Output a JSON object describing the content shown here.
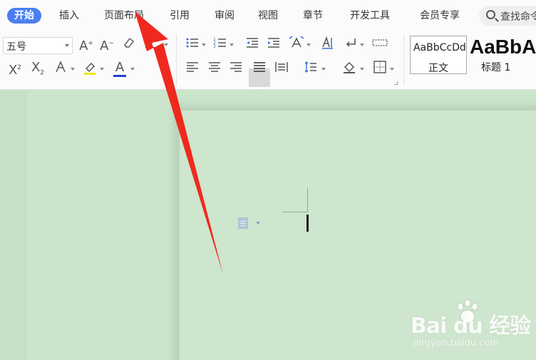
{
  "menu": {
    "tabs": [
      {
        "label": "开始",
        "active": true
      },
      {
        "label": "插入"
      },
      {
        "label": "页面布局"
      },
      {
        "label": "引用"
      },
      {
        "label": "审阅"
      },
      {
        "label": "视图"
      },
      {
        "label": "章节"
      },
      {
        "label": "开发工具"
      },
      {
        "label": "会员专享"
      }
    ],
    "search_label": "查找命令"
  },
  "ribbon": {
    "font_size_value": "五号",
    "icons": [
      "increase-font-size-icon",
      "decrease-font-size-icon",
      "clear-format-icon",
      "phonetic-guide-icon",
      "superscript-icon",
      "subscript-icon",
      "text-effect-icon",
      "highlight-icon",
      "font-color-icon",
      "bullet-list-icon",
      "numbered-list-icon",
      "decrease-indent-icon",
      "increase-indent-icon",
      "chinese-layout-icon",
      "sort-icon",
      "show-marks-icon",
      "table-icon",
      "align-left-icon",
      "align-center-icon",
      "align-right-icon",
      "justify-icon",
      "distributed-icon",
      "line-spacing-icon",
      "shading-icon",
      "borders-icon"
    ],
    "buttons": {
      "grow_font": "A",
      "shrink_font": "A",
      "superscript": "X",
      "superscript_mark": "2",
      "subscript": "X",
      "subscript_mark": "2",
      "font_color": "A"
    },
    "styles": [
      {
        "sample": "AaBbCcDd",
        "name": "正文"
      },
      {
        "sample": "AaBbA",
        "name": "标题 1"
      }
    ],
    "highlight_color": "#f5e61a",
    "font_color_bar": "#1f3fd8"
  },
  "watermark": {
    "main": "Bai du 经验",
    "sub": "jingyan.baidu.com"
  },
  "annotation": {
    "arrow_color": "#f0291e"
  }
}
